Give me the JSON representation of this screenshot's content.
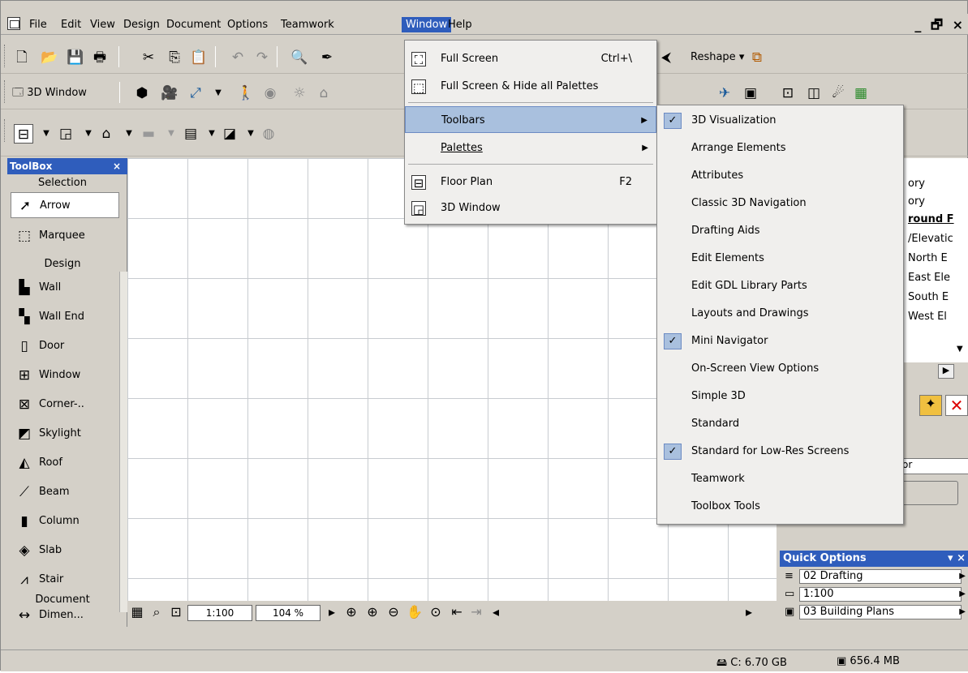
{
  "menubar": {
    "items": [
      "File",
      "Edit",
      "View",
      "Design",
      "Document",
      "Options",
      "Teamwork",
      "Window",
      "Help"
    ],
    "active": "Window"
  },
  "window_controls": "_ 🗗 ×",
  "toolbar": {
    "window_3d_label": "3D Window",
    "reshape_label": "Reshape"
  },
  "window_menu": {
    "items": [
      {
        "label": "Full Screen",
        "shortcut": "Ctrl+\\",
        "icon": "full-screen-icon"
      },
      {
        "label": "Full Screen & Hide all Palettes",
        "shortcut": "",
        "icon": "hide-palettes-icon"
      },
      {
        "label": "Toolbars",
        "shortcut": "",
        "submenu": true,
        "highlighted": true
      },
      {
        "label": "Palettes",
        "shortcut": "",
        "submenu": true
      },
      {
        "label": "Floor Plan",
        "shortcut": "F2",
        "icon": "floor-plan-icon"
      },
      {
        "label": "3D Window",
        "shortcut": "",
        "icon": "window-3d-icon"
      }
    ]
  },
  "toolbars_submenu": {
    "items": [
      {
        "label": "3D Visualization",
        "checked": true
      },
      {
        "label": "Arrange Elements",
        "checked": false
      },
      {
        "label": "Attributes",
        "checked": false
      },
      {
        "label": "Classic 3D Navigation",
        "checked": false
      },
      {
        "label": "Drafting Aids",
        "checked": false
      },
      {
        "label": "Edit Elements",
        "checked": false
      },
      {
        "label": "Edit GDL Library Parts",
        "checked": false
      },
      {
        "label": "Layouts and Drawings",
        "checked": false
      },
      {
        "label": "Mini Navigator",
        "checked": true
      },
      {
        "label": "On-Screen View Options",
        "checked": false
      },
      {
        "label": "Simple 3D",
        "checked": false
      },
      {
        "label": "Standard",
        "checked": false
      },
      {
        "label": "Standard for Low-Res Screens",
        "checked": true
      },
      {
        "label": "Teamwork",
        "checked": false
      },
      {
        "label": "Toolbox Tools",
        "checked": false
      }
    ]
  },
  "toolbox": {
    "title": "ToolBox",
    "sections": {
      "selection": "Selection",
      "design": "Design",
      "document": "Document"
    },
    "tools": [
      "Arrow",
      "Marquee",
      "Wall",
      "Wall End",
      "Door",
      "Window",
      "Corner-..",
      "Skylight",
      "Roof",
      "Beam",
      "Column",
      "Slab",
      "Stair",
      "Dimen..."
    ]
  },
  "navigator": {
    "items": [
      "ory",
      "ory",
      "round F",
      "/Elevatic",
      "North E",
      "East Ele",
      "South E",
      "West El"
    ]
  },
  "right_panel": {
    "field_value": "or"
  },
  "quick_options": {
    "title": "Quick Options",
    "rows": [
      "02 Drafting",
      "1:100",
      "03 Building Plans"
    ]
  },
  "navbar": {
    "scale": "1:100",
    "zoom": "104 %"
  },
  "statusbar": {
    "disk": "C: 6.70 GB",
    "memory": "656.4 MB"
  }
}
